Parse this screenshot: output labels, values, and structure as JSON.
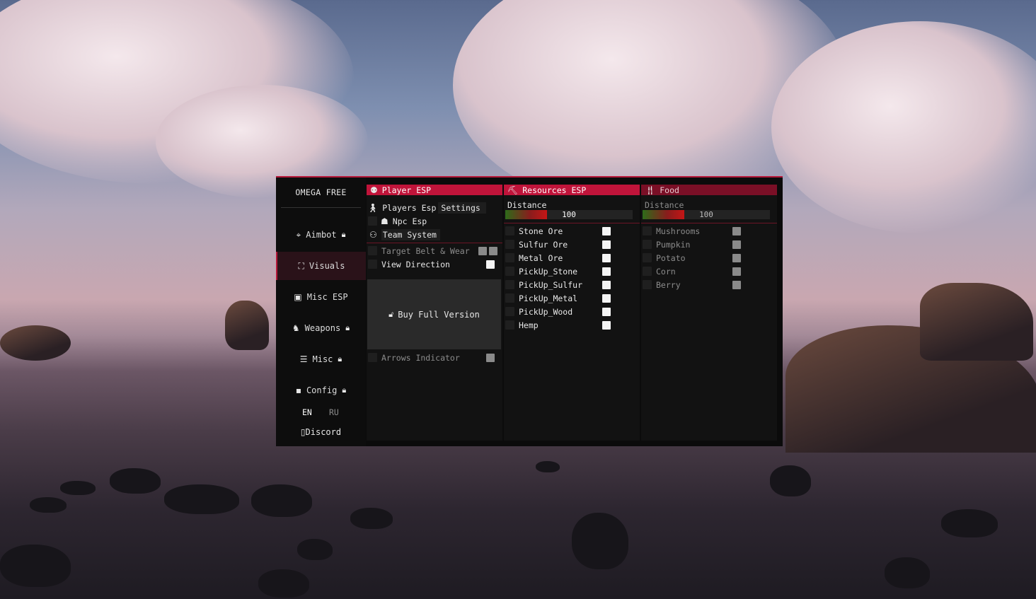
{
  "sidebar": {
    "title": "OMEGA FREE",
    "items": [
      {
        "label": "Aimbot",
        "icon": "crosshair-icon",
        "locked": true
      },
      {
        "label": "Visuals",
        "icon": "users-view-icon",
        "locked": false,
        "active": true
      },
      {
        "label": "Misc ESP",
        "icon": "box-icon",
        "locked": false
      },
      {
        "label": "Weapons",
        "icon": "soldier-icon",
        "locked": true
      },
      {
        "label": "Misc",
        "icon": "list-icon",
        "locked": true
      },
      {
        "label": "Config",
        "icon": "floppy-icon",
        "locked": true
      }
    ],
    "languages": [
      "EN",
      "RU"
    ],
    "active_language": "EN",
    "discord_label": "Discord"
  },
  "player_esp": {
    "header": "Player ESP",
    "players_esp_label": "Players Esp",
    "settings_label": "Settings",
    "npc_esp_label": "Npc Esp",
    "team_system_label": "Team System",
    "target_belt_label": "Target Belt & Wear",
    "view_direction_label": "View Direction",
    "buy_label": "Buy Full Version",
    "arrows_label": "Arrows Indicator"
  },
  "resources_esp": {
    "header": "Resources ESP",
    "distance_label": "Distance",
    "distance_value": "100",
    "distance_fraction": 0.33,
    "items": [
      "Stone Ore",
      "Sulfur Ore",
      "Metal Ore",
      "PickUp_Stone",
      "PickUp_Sulfur",
      "PickUp_Metal",
      "PickUp_Wood",
      "Hemp"
    ]
  },
  "food": {
    "header": "Food",
    "distance_label": "Distance",
    "distance_value": "100",
    "distance_fraction": 0.33,
    "items": [
      "Mushrooms",
      "Pumpkin",
      "Potato",
      "Corn",
      "Berry"
    ]
  },
  "colors": {
    "accent": "#c0143a",
    "accent_dark": "#7a0f26",
    "panel": "#0b0b0b",
    "column": "#121212"
  }
}
